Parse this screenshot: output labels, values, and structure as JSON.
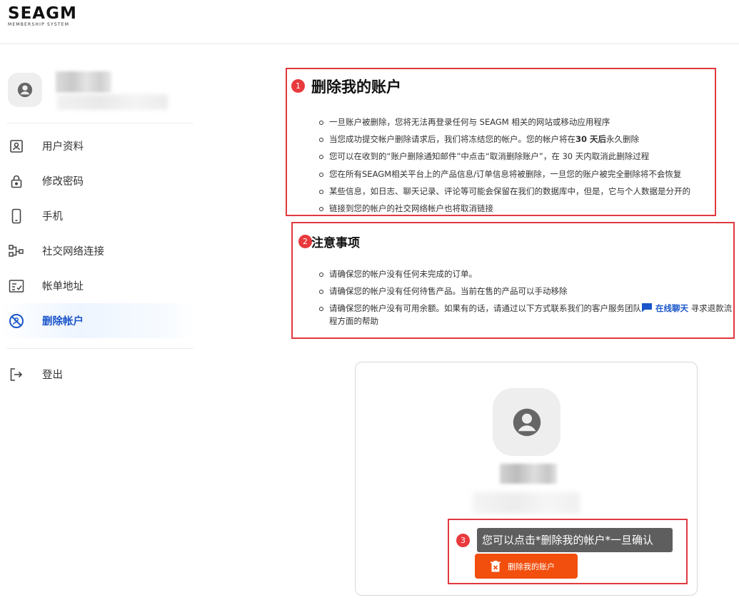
{
  "header": {
    "logo_text": "SEAGM",
    "logo_sub": "MEMBERSHIP SYSTEM"
  },
  "sidebar": {
    "items": [
      {
        "label": "用户资料",
        "icon": "profile-card-icon"
      },
      {
        "label": "修改密码",
        "icon": "lock-icon"
      },
      {
        "label": "手机",
        "icon": "phone-icon"
      },
      {
        "label": "社交网络连接",
        "icon": "social-network-icon"
      },
      {
        "label": "帐单地址",
        "icon": "billing-address-icon"
      },
      {
        "label": "删除帐户",
        "icon": "delete-account-icon",
        "active": true
      }
    ],
    "logout_label": "登出"
  },
  "annotations": [
    "1",
    "2",
    "3"
  ],
  "delete_section": {
    "title": "删除我的账户",
    "bullets": [
      "一旦账户被删除，您将无法再登录任何与 SEAGM 相关的网站或移动应用程序",
      "当您成功提交帐户删除请求后，我们将冻结您的帐户。您的帐户将在",
      "您可以在收到的“账户删除通知邮件”中点击“取消删除账户”，在 30 天内取消此删除过程",
      "您在所有SEAGM相关平台上的产品信息/订单信息将被删除，一旦您的账户被完全删除将不会恢复",
      "某些信息，如日志、聊天记录、评论等可能会保留在我们的数据库中，但是，它与个人数据是分开的",
      "链接到您的帐户的社交网络帐户也将取消链接"
    ],
    "bullet2_bold": "30 天后",
    "bullet2_tail": "永久删除"
  },
  "notice_section": {
    "title": "注意事项",
    "bullets": [
      "请确保您的帐户没有任何未完成的订单。",
      "请确保您的帐户没有任何待售产品。当前在售的产品可以手动移除",
      "请确保您的帐户没有可用余额。如果有的话，请通过以下方式联系我们的客户服务团队"
    ],
    "chat_link": "在线聊天",
    "bullet3_tail": "寻求退款流程方面的帮助"
  },
  "card": {
    "tooltip": "您可以点击*删除我的帐户*一旦确认",
    "delete_button": "删除我的账户"
  },
  "colors": {
    "accent": "#1a56c9",
    "danger": "#f24e0d",
    "annotation": "#e0393e"
  }
}
